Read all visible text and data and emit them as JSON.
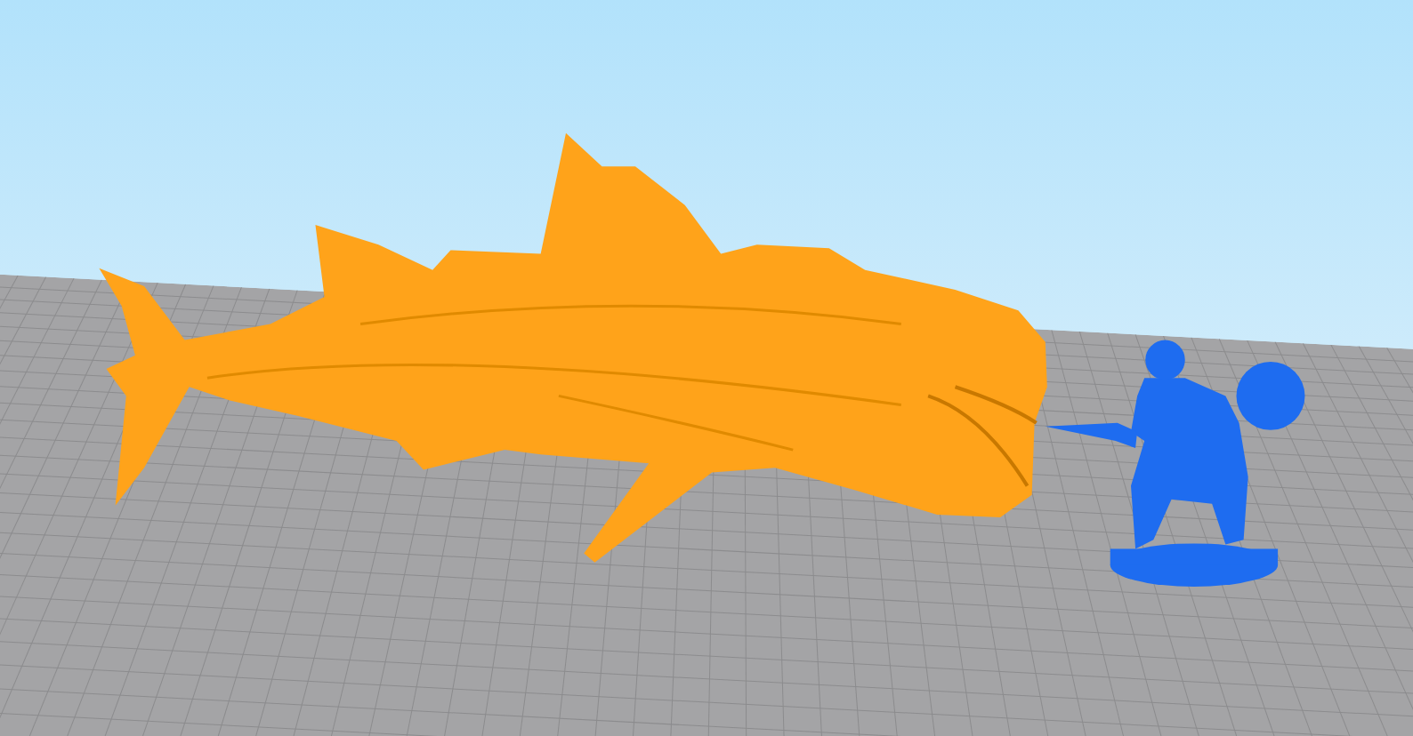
{
  "models": [
    {
      "kind": "shark",
      "color": "#ffa31a"
    },
    {
      "kind": "warrior",
      "color": "#1e6cf0"
    }
  ]
}
